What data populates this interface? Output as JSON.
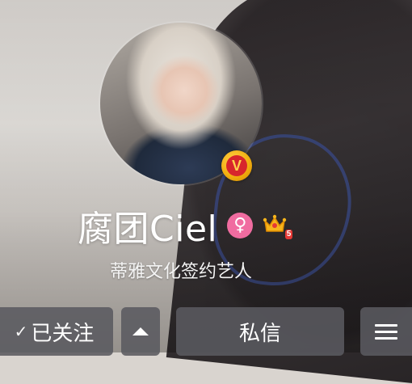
{
  "profile": {
    "name": "腐团Ciel",
    "subtitle": "蒂雅文化签约艺人",
    "verified_badge": "V",
    "gender_symbol": "♀",
    "level_badge": "5"
  },
  "actions": {
    "follow_check": "✓",
    "follow_label": "已关注",
    "message_label": "私信"
  },
  "icons": {
    "verified": "verified-v-icon",
    "gender": "female-gender-icon",
    "crown": "crown-level-icon",
    "expand": "triangle-up-icon",
    "menu": "hamburger-menu-icon"
  },
  "colors": {
    "verified_ring": "#f2b010",
    "verified_core": "#d7262c",
    "gender": "#f06ca0",
    "button_bg": "#5a5a60"
  }
}
